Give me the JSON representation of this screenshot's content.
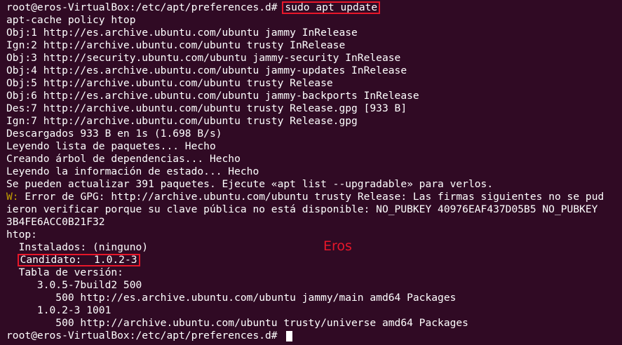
{
  "terminal": {
    "prompt": "root@eros-VirtualBox:/etc/apt/preferences.d# ",
    "command_update": "sudo apt update",
    "command_policy": "apt-cache policy htop",
    "lines_output": [
      "Obj:1 http://es.archive.ubuntu.com/ubuntu jammy InRelease",
      "Ign:2 http://archive.ubuntu.com/ubuntu trusty InRelease",
      "Obj:3 http://security.ubuntu.com/ubuntu jammy-security InRelease",
      "Obj:4 http://es.archive.ubuntu.com/ubuntu jammy-updates InRelease",
      "Obj:5 http://archive.ubuntu.com/ubuntu trusty Release",
      "Obj:6 http://es.archive.ubuntu.com/ubuntu jammy-backports InRelease",
      "Des:7 http://archive.ubuntu.com/ubuntu trusty Release.gpg [933 B]",
      "Ign:7 http://archive.ubuntu.com/ubuntu trusty Release.gpg",
      "Descargados 933 B en 1s (1.698 B/s)",
      "Leyendo lista de paquetes... Hecho",
      "Creando árbol de dependencias... Hecho",
      "Leyendo la información de estado... Hecho",
      "Se pueden actualizar 391 paquetes. Ejecute «apt list --upgradable» para verlos."
    ],
    "warning_prefix": "W:",
    "warning_line1": " Error de GPG: http://archive.ubuntu.com/ubuntu trusty Release: Las firmas siguientes no se pud",
    "warning_line2": "ieron verificar porque su clave pública no está disponible: NO_PUBKEY 40976EAF437D05B5 NO_PUBKEY",
    "warning_line3": "3B4FE6ACC0B21F32",
    "policy_header": "htop:",
    "installed": "  Instalados: (ninguno)",
    "candidate": "Candidato:  1.0.2-3",
    "version_table": "  Tabla de versión:",
    "version1": "     3.0.5-7build2 500",
    "version1_source": "        500 http://es.archive.ubuntu.com/ubuntu jammy/main amd64 Packages",
    "version2": "     1.0.2-3 1001",
    "version2_source": "        500 http://archive.ubuntu.com/ubuntu trusty/universe amd64 Packages"
  },
  "watermark": "Eros",
  "colors": {
    "background": "#300a24",
    "text": "#ffffff",
    "highlight_box": "#e8172a",
    "warning": "#c4a000"
  }
}
